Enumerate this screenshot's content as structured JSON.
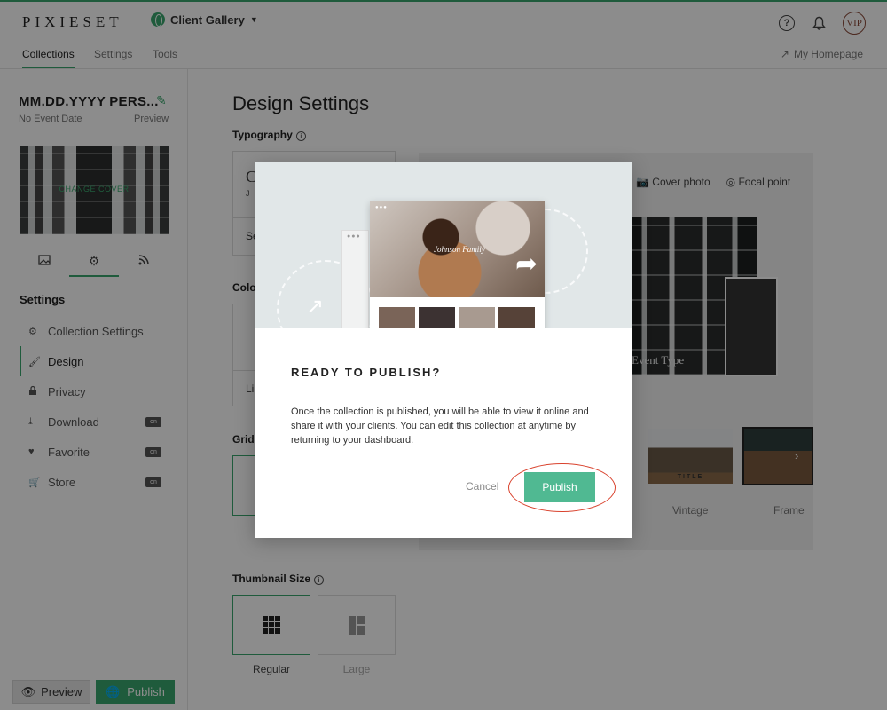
{
  "topbar": {
    "logo": "PIXIESET",
    "app_switch": "Client Gallery",
    "help_icon": "?",
    "avatar": "VIP"
  },
  "nav": {
    "tabs": [
      "Collections",
      "Settings",
      "Tools"
    ],
    "active": "Collections",
    "my_homepage": "My Homepage"
  },
  "sidebar": {
    "collection_title": "MM.DD.YYYY PERS...",
    "event_date": "No Event Date",
    "preview": "Preview",
    "change_cover": "CHANGE COVER",
    "settings_heading": "Settings",
    "items": [
      {
        "label": "Collection Settings",
        "icon": "gear-icon",
        "badge": ""
      },
      {
        "label": "Design",
        "icon": "brush-icon",
        "badge": ""
      },
      {
        "label": "Privacy",
        "icon": "lock-icon",
        "badge": ""
      },
      {
        "label": "Download",
        "icon": "download-icon",
        "badge": "on"
      },
      {
        "label": "Favorite",
        "icon": "heart-icon",
        "badge": "on"
      },
      {
        "label": "Store",
        "icon": "cart-icon",
        "badge": "on"
      }
    ],
    "preview_button": "Preview",
    "publish_button": "Publish"
  },
  "main": {
    "title": "Design Settings",
    "typography_label": "Typography",
    "color_label": "Colo",
    "grid_label": "Grid",
    "typo_card_text": "C",
    "typo_card_sub": "J U",
    "typo_card_footer": "Se",
    "color_card_footer": "Li",
    "cover_tools": [
      "Cover photo",
      "Focal point"
    ],
    "cover_event_type": "Event Type",
    "cover_styles": [
      "Vintage",
      "Frame"
    ],
    "vintage_thumb_title": "TITLE",
    "thumbnail_size_label": "Thumbnail Size",
    "thumbnail_sizes": [
      "Regular",
      "Large"
    ]
  },
  "modal": {
    "hero_name": "Johnson Family",
    "title": "READY TO PUBLISH?",
    "body": "Once the collection is published, you will be able to view it online and share it with your clients. You can edit this collection at anytime by returning to your dashboard.",
    "cancel": "Cancel",
    "publish": "Publish"
  },
  "colors": {
    "accent": "#3aa76d",
    "publish_button": "#50b992",
    "highlight_ring": "#d9432e"
  }
}
